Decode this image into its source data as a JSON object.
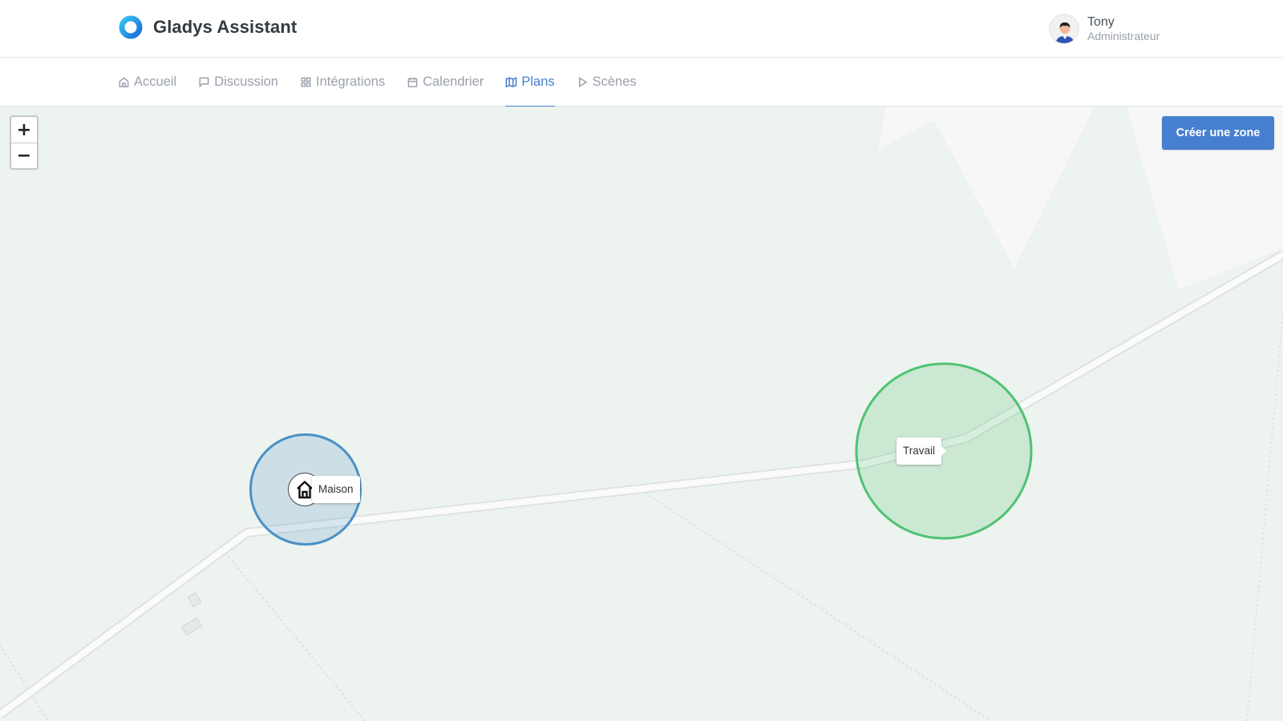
{
  "app": {
    "name": "Gladys Assistant"
  },
  "user": {
    "name": "Tony",
    "role": "Administrateur"
  },
  "nav": {
    "items": [
      {
        "label": "Accueil",
        "icon": "home-icon",
        "active": false
      },
      {
        "label": "Discussion",
        "icon": "message-square-icon",
        "active": false
      },
      {
        "label": "Intégrations",
        "icon": "grid-icon",
        "active": false
      },
      {
        "label": "Calendrier",
        "icon": "calendar-icon",
        "active": false
      },
      {
        "label": "Plans",
        "icon": "map-icon",
        "active": true
      },
      {
        "label": "Scènes",
        "icon": "play-icon",
        "active": false
      }
    ]
  },
  "map": {
    "zoom_in": "+",
    "zoom_out": "−",
    "create_zone_label": "Créer une zone",
    "zones": [
      {
        "label": "Maison",
        "color": "#4a90c8"
      },
      {
        "label": "Travail",
        "color": "#4ec274"
      }
    ]
  },
  "colors": {
    "accent": "#467fcf",
    "map_bg": "#edf3ee"
  }
}
